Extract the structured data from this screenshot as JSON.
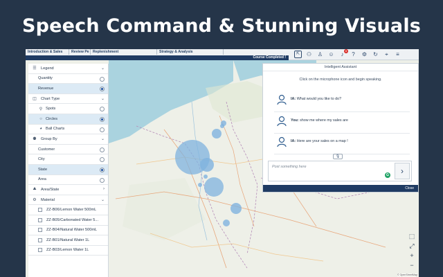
{
  "headline": "Speech Command & Stunning Visuals",
  "nav": {
    "tabs": [
      "Introduction & Sales",
      "Review Pe",
      "Replenishment",
      "Strategy & Analysis"
    ],
    "progress_label": "Course Completed !",
    "notification_count": "8"
  },
  "panel": {
    "legend": "Legend",
    "quantity": "Quantity",
    "revenue": "Revenue",
    "chart_type": "Chart Type",
    "spots": "Spots",
    "circles": "Circles",
    "ball_charts": "Ball Charts",
    "group_by": "Group By",
    "customer": "Customer",
    "city": "City",
    "state": "State",
    "area": "Area",
    "area_state": "Area/State",
    "material": "Material",
    "materials": [
      "ZZ-B06/Lemon Water 500mL",
      "ZZ-B05/Carbonated Water 5...",
      "ZZ-B04/Natural Water 500mL",
      "ZZ-B01/Natural Water 1L",
      "ZZ-B03/Lemon Water 1L"
    ]
  },
  "assistant": {
    "title": "Intelligent Assistant",
    "hint": "Click on the microphone icon and begin speaking.",
    "messages": [
      {
        "speaker": "IA:",
        "text": "What would you like to do?"
      },
      {
        "speaker": "You:",
        "text": "show me where my sales are"
      },
      {
        "speaker": "IA:",
        "text": "Here are your sales on a map !"
      }
    ],
    "placeholder": "Post something here",
    "close": "Close"
  },
  "map": {
    "attribution": "© OpenStreetMap"
  },
  "colors": {
    "navy": "#1f3b63",
    "bubble": "#7fb3df",
    "selected_row": "#dceaf5"
  }
}
